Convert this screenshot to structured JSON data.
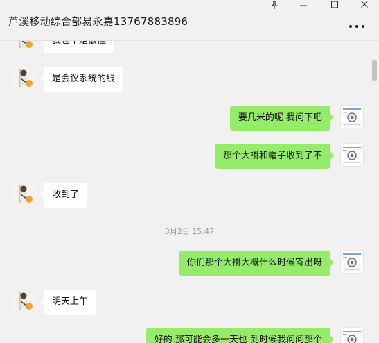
{
  "window": {
    "pin_icon": "pin-icon",
    "minimize_icon": "minimize-icon",
    "maximize_icon": "maximize-icon",
    "close_icon": "close-icon"
  },
  "header": {
    "title": "芦溪移动综合部易永嘉13767883896",
    "more_icon": "more-horizontal-icon"
  },
  "messages": [
    {
      "side": "in",
      "text": "我也不是很懂"
    },
    {
      "side": "in",
      "text": "是会议系统的线"
    },
    {
      "side": "out",
      "text": "要几米的呢 我问下吧"
    },
    {
      "side": "out",
      "text": "那个大褂和帽子收到了不"
    },
    {
      "side": "in",
      "text": "收到了"
    },
    {
      "side": "out",
      "text": "你们那个大褂大概什么时候寄出呀"
    },
    {
      "side": "in",
      "text": "明天上午"
    },
    {
      "side": "out",
      "text": "好的 那可能会多一天也  到时候我问问那个"
    }
  ],
  "timestamp": "3月2日 15:47",
  "colors": {
    "background": "#f1f1f1",
    "incoming_bubble": "#ffffff",
    "outgoing_bubble": "#95ec69",
    "timestamp_text": "#9a9a9a"
  }
}
